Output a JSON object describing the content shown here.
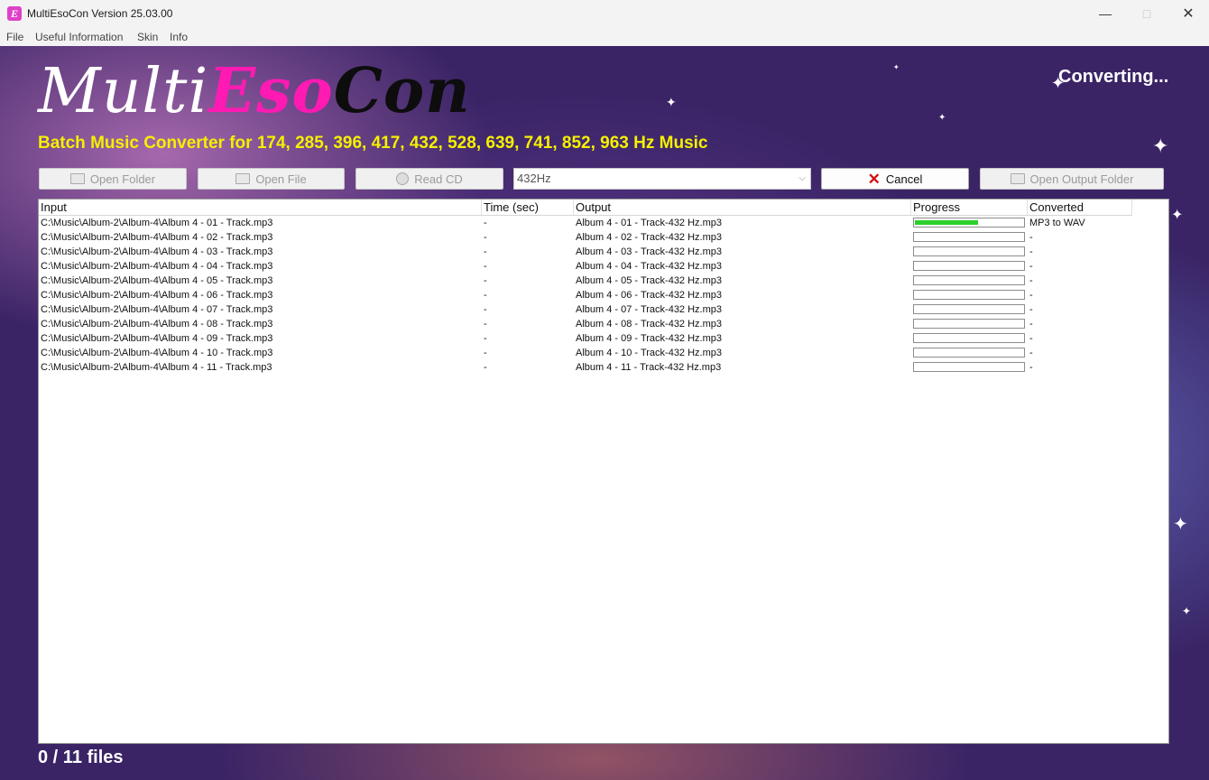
{
  "window": {
    "title": "MultiEsoCon Version 25.03.00"
  },
  "menu": [
    "File",
    "Useful Information",
    "Skin",
    "Info"
  ],
  "logo": {
    "part1": "Multi",
    "part2": "Eso",
    "part3": "Con"
  },
  "subtitle": "Batch Music Converter for 174, 285, 396, 417, 432, 528, 639, 741, 852, 963 Hz Music",
  "status": "Converting...",
  "toolbar": {
    "open_folder": "Open Folder",
    "open_file": "Open File",
    "read_cd": "Read CD",
    "frequency": "432Hz",
    "cancel": "Cancel",
    "open_output_folder": "Open Output Folder"
  },
  "columns": {
    "input": "Input",
    "time": "Time (sec)",
    "output": "Output",
    "progress": "Progress",
    "converted": "Converted"
  },
  "rows": [
    {
      "input": "C:\\Music\\Album-2\\Album-4\\Album 4 - 01 - Track.mp3",
      "time": "-",
      "output": "Album 4 - 01 - Track-432 Hz.mp3",
      "progress": 0.58,
      "converted": "MP3 to WAV"
    },
    {
      "input": "C:\\Music\\Album-2\\Album-4\\Album 4 - 02 - Track.mp3",
      "time": "-",
      "output": "Album 4 - 02 - Track-432 Hz.mp3",
      "progress": 0,
      "converted": "-"
    },
    {
      "input": "C:\\Music\\Album-2\\Album-4\\Album 4 - 03 - Track.mp3",
      "time": "-",
      "output": "Album 4 - 03 - Track-432 Hz.mp3",
      "progress": 0,
      "converted": "-"
    },
    {
      "input": "C:\\Music\\Album-2\\Album-4\\Album 4 - 04 - Track.mp3",
      "time": "-",
      "output": "Album 4 - 04 - Track-432 Hz.mp3",
      "progress": 0,
      "converted": "-"
    },
    {
      "input": "C:\\Music\\Album-2\\Album-4\\Album 4 - 05 - Track.mp3",
      "time": "-",
      "output": "Album 4 - 05 - Track-432 Hz.mp3",
      "progress": 0,
      "converted": "-"
    },
    {
      "input": "C:\\Music\\Album-2\\Album-4\\Album 4 - 06 - Track.mp3",
      "time": "-",
      "output": "Album 4 - 06 - Track-432 Hz.mp3",
      "progress": 0,
      "converted": "-"
    },
    {
      "input": "C:\\Music\\Album-2\\Album-4\\Album 4 - 07 - Track.mp3",
      "time": "-",
      "output": "Album 4 - 07 - Track-432 Hz.mp3",
      "progress": 0,
      "converted": "-"
    },
    {
      "input": "C:\\Music\\Album-2\\Album-4\\Album 4 - 08 - Track.mp3",
      "time": "-",
      "output": "Album 4 - 08 - Track-432 Hz.mp3",
      "progress": 0,
      "converted": "-"
    },
    {
      "input": "C:\\Music\\Album-2\\Album-4\\Album 4 - 09 - Track.mp3",
      "time": "-",
      "output": "Album 4 - 09 - Track-432 Hz.mp3",
      "progress": 0,
      "converted": "-"
    },
    {
      "input": "C:\\Music\\Album-2\\Album-4\\Album 4 - 10 - Track.mp3",
      "time": "-",
      "output": "Album 4 - 10 - Track-432 Hz.mp3",
      "progress": 0,
      "converted": "-"
    },
    {
      "input": "C:\\Music\\Album-2\\Album-4\\Album 4 - 11 - Track.mp3",
      "time": "-",
      "output": "Album 4 - 11 - Track-432 Hz.mp3",
      "progress": 0,
      "converted": "-"
    }
  ],
  "files_count": "0 / 11 files",
  "colors": {
    "subtitle": "#f5f000",
    "logo_eso": "#ff1ab3",
    "progress_fill": "#2bd12b",
    "cancel_icon": "#d01010"
  }
}
